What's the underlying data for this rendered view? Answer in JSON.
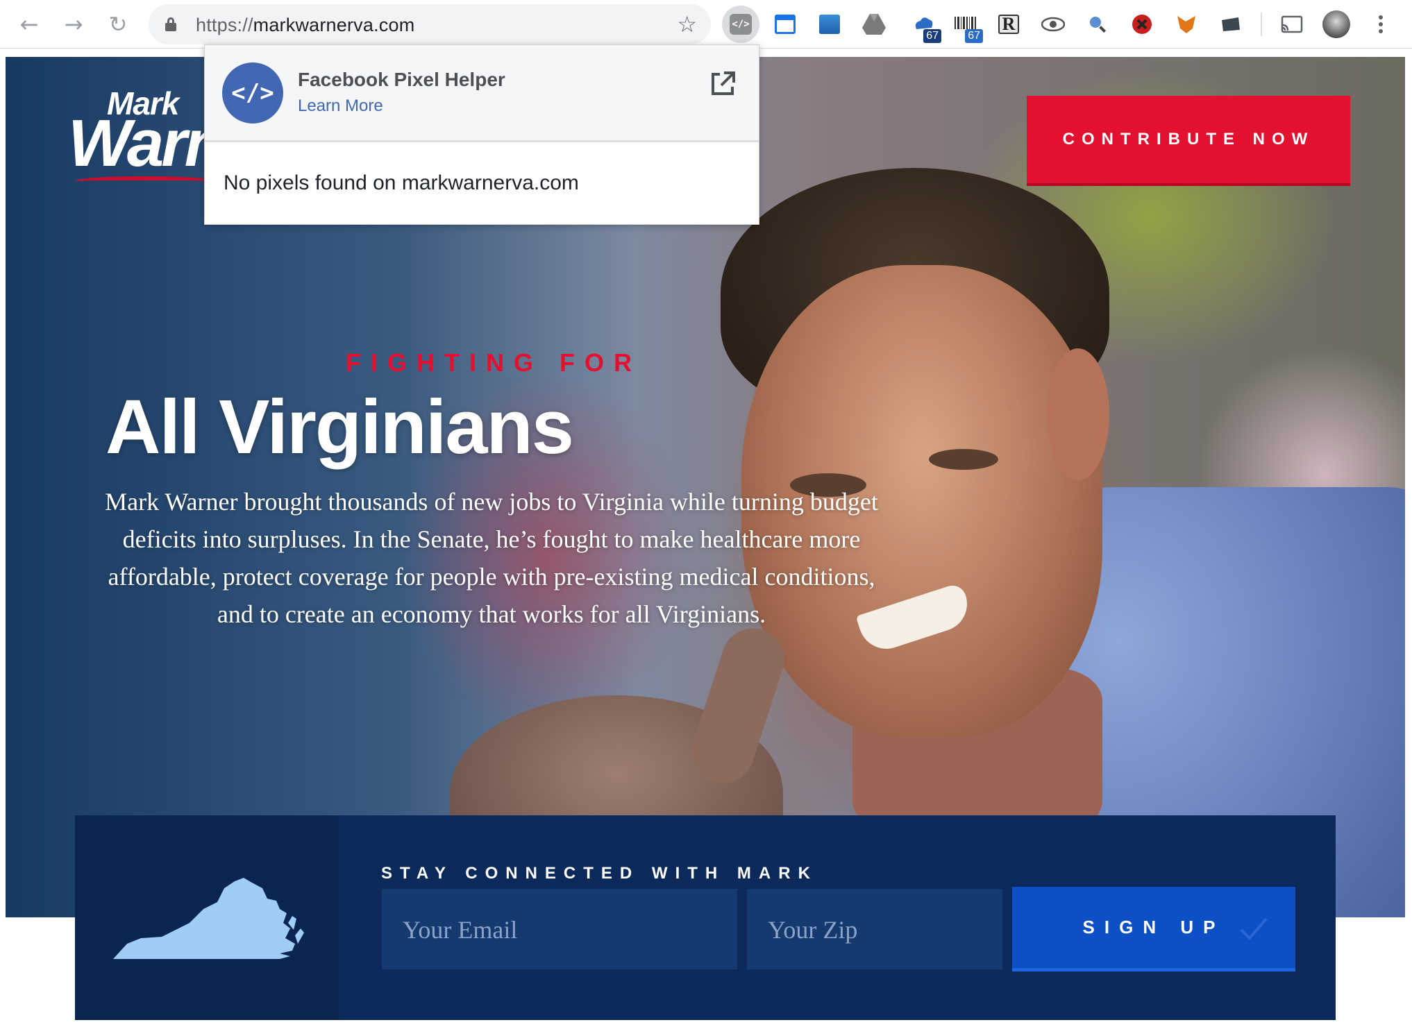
{
  "browser": {
    "url_scheme": "https://",
    "url_host": "markwarnerva.com",
    "extensions": [
      {
        "name": "pixel-helper-icon"
      },
      {
        "name": "window-icon"
      },
      {
        "name": "screenshot-icon"
      },
      {
        "name": "drive-icon"
      },
      {
        "name": "cloud-badge-icon",
        "badge": "67"
      },
      {
        "name": "barcode-badge-icon",
        "badge": "67"
      },
      {
        "name": "readability-icon",
        "letter": "R"
      },
      {
        "name": "eye-icon"
      },
      {
        "name": "search-tool-icon"
      },
      {
        "name": "block-icon"
      },
      {
        "name": "fox-icon"
      },
      {
        "name": "folder-icon"
      },
      {
        "name": "cast-icon"
      },
      {
        "name": "profile-avatar"
      },
      {
        "name": "menu-icon"
      }
    ]
  },
  "popup": {
    "title": "Facebook Pixel Helper",
    "link": "Learn More",
    "message": "No pixels found on markwarnerva.com",
    "logo_glyph": "</>"
  },
  "site": {
    "logo_top": "Mark",
    "logo_main": "Warner",
    "contribute": "CONTRIBUTE NOW",
    "eyebrow": "FIGHTING FOR",
    "headline": "All Virginians",
    "blurb": "Mark Warner brought thousands of new jobs to Virginia while turning budget deficits into surpluses. In the Senate, he’s fought to make healthcare more affordable, protect coverage for people with pre-existing medical conditions, and to create an economy that works for all Virginians.",
    "signup": {
      "title": "STAY CONNECTED WITH MARK",
      "email_placeholder": "Your Email",
      "zip_placeholder": "Your Zip",
      "button": "SIGN UP"
    },
    "colors": {
      "accent_red": "#e3102f",
      "navy": "#0b2a5b",
      "button_blue": "#0d4fc4",
      "facebook_blue": "#4267b2"
    }
  }
}
